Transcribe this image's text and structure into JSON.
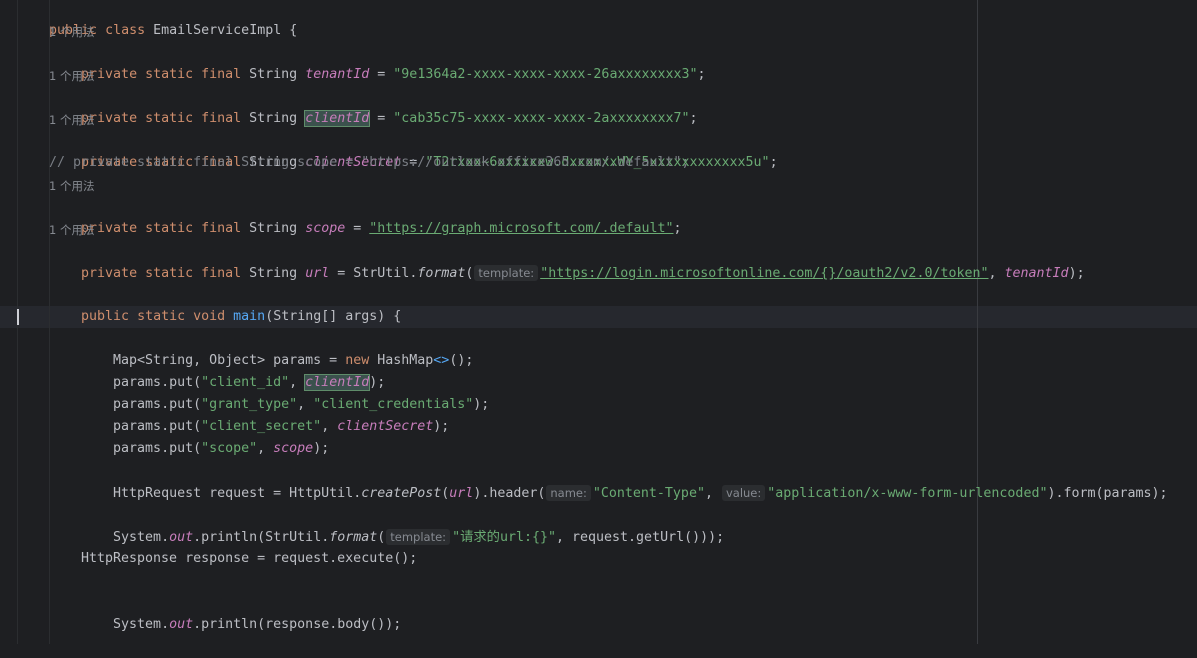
{
  "editor": {
    "class_decl": {
      "kw": "public class",
      "name": "EmailServiceImpl",
      "brace": "{"
    },
    "usage_hint": "1 个用法",
    "mods": "private static final",
    "type_string": "String",
    "tenant": {
      "name": "tenantId",
      "value": "\"9e1364a2-xxxx-xxxx-xxxx-26axxxxxxxx3\""
    },
    "client": {
      "name": "clientId",
      "value": "\"cab35c75-xxxx-xxxx-xxxx-2axxxxxxxx7\""
    },
    "secret": {
      "name": "clientSecret",
      "value": "\"T2rxxx~6xxxxxxw.dxxxxxxWY_5xxxxxxxxxxxx5u\""
    },
    "comment_line": "// private static final String scope = \"https://outlook.office365.com/.default\";",
    "scope": {
      "name": "scope",
      "value": "\"https://graph.microsoft.com/.default\""
    },
    "url_decl": {
      "name": "url",
      "call_prefix": "StrUtil.",
      "method": "format",
      "hint_template": "template:",
      "value": "\"https://login.microsoftonline.com/{}/oauth2/v2.0/token\"",
      "arg": "tenantId"
    },
    "main_decl": {
      "kw": "public static void",
      "name": "main",
      "params": "(String[] args) {"
    },
    "map_line": {
      "text": "Map<String, Object> params = ",
      "kw_new": "new",
      "type": "HashMap",
      "diamond": "<>",
      "end": "();"
    },
    "put1": {
      "prefix": "params.put(",
      "key": "\"client_id\"",
      "arg": "clientId",
      "end": ");"
    },
    "put2": {
      "prefix": "params.put(",
      "key": "\"grant_type\"",
      "value": "\"client_credentials\"",
      "end": ");"
    },
    "put3": {
      "prefix": "params.put(",
      "key": "\"client_secret\"",
      "arg": "clientSecret",
      "end": ");"
    },
    "put4": {
      "prefix": "params.put(",
      "key": "\"scope\"",
      "arg": "scope",
      "end": ");"
    },
    "request_line": {
      "prefix": "HttpRequest request = HttpUtil.",
      "method": "createPost",
      "arg": "url",
      "header": ").header(",
      "hint_name": "name:",
      "ct_key": "\"Content-Type\"",
      "hint_value": "value:",
      "ct_value": "\"application/x-www-form-urlencoded\"",
      "end": ").form(params);"
    },
    "println1": {
      "prefix": "System.",
      "out": "out",
      "mid": ".println(StrUtil.",
      "method": "format",
      "hint_template": "template:",
      "str": "\"请求的url:{}\"",
      "end": ", request.getUrl()));"
    },
    "response_line": {
      "text": "HttpResponse response = request.execute();"
    },
    "println2": {
      "prefix": "System.",
      "out": "out",
      "end": ".println(response.body());"
    }
  }
}
